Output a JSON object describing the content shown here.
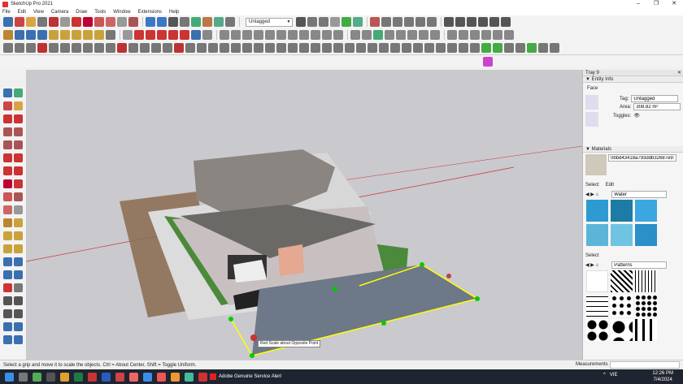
{
  "window": {
    "title": "SketchUp Pro 2021",
    "controls": [
      "–",
      "❐",
      "✕"
    ]
  },
  "menu": [
    "File",
    "Edit",
    "View",
    "Camera",
    "Draw",
    "Tools",
    "Window",
    "Extensions",
    "Help"
  ],
  "toolbar": {
    "tag_select": "Untagged"
  },
  "viewport": {
    "tooltip": "Red Scale about Opposite Point",
    "colors": {
      "sky": "#c9c9ce",
      "roof": "#85817c",
      "wall": "#dedede",
      "grass": "#3f7a30",
      "road": "#6d7888",
      "selection": "#ffff00",
      "grip": "#00c000"
    }
  },
  "tray": {
    "title": "Tray 9",
    "entity_info": {
      "header": "Entity Info",
      "type": "Face",
      "tag_label": "Tag:",
      "tag_value": "Untagged",
      "area_label": "Area:",
      "area_value": "308.82 m²",
      "toggles_label": "Toggles:"
    },
    "materials": {
      "header": "Materials",
      "material_name": "0bbd43418a793ddb32687e9141",
      "tab_select": "Select",
      "tab_edit": "Edit",
      "collection": "Water",
      "select_label": "Select",
      "collection2": "Patterns"
    }
  },
  "statusbar": {
    "hint": "Select a grip and move it to scale the objects. Ctrl = About Center, Shift = Toggle Uniform.",
    "measurements_label": "Measurements"
  },
  "taskbar": {
    "alert": "Adobe Genuine Service Alert",
    "time": "12:26 PM",
    "date": "7/4/2024",
    "lang": "VIE"
  }
}
